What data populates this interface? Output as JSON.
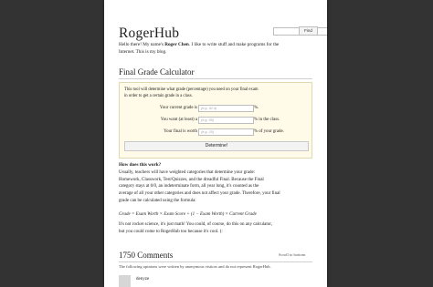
{
  "header": {
    "site_title": "RogerHub",
    "search_placeholder": "",
    "find_label": "Find"
  },
  "intro": {
    "prefix": "Hello there! My name's ",
    "name": "Roger Chen",
    "line1_rest": ". I like to write stuff and make programs for the",
    "line2": "Internet. This is my blog."
  },
  "calculator": {
    "title": "Final Grade Calculator",
    "description_line1": "This tool will determine what grade (percentage) you need on your final exam",
    "description_line2": "in order to get a certain grade in a class.",
    "rows": [
      {
        "label": "Your current grade is",
        "placeholder": "(e.g. 92.4)",
        "suffix": "%."
      },
      {
        "label": "You want (at least) a",
        "placeholder": "(e.g. 85)",
        "suffix": "% in the class."
      },
      {
        "label": "Your final is worth",
        "placeholder": "(e.g. 20)",
        "suffix": "% of your grade."
      }
    ],
    "button_label": "Determine!"
  },
  "how": {
    "title": "How does this work?",
    "lines": [
      "Usually, teachers will have weighted categories that determine your grade:",
      "Homework, Classwork, Test/Quizzes, and the dreadful Final. Because the Final",
      "category stays at 0/0, an indeterminate form, all year long, it's counted as the",
      "average of all your other categories and does not affect your grade. Therefore, your final",
      "grade can be calculated using the formula:"
    ],
    "formula": "Grade = Exam Worth × Exam Score + (1 − Exam Worth) × Current Grade",
    "note_line1": "It's not rocket science, it's just math! You could, of course, do this on any calculator,",
    "note_line2": "but you could come to RogerHub too because it's cool. (:"
  },
  "comments": {
    "title": "1750 Comments",
    "scroll_link": "Scroll to bottom",
    "note": "The following opinions were written by anonymous visitors and do not represent RogerHub.",
    "first_author": "denyze"
  },
  "colors": {
    "background": "#333333",
    "page": "#ffffff",
    "calculator_bg": "#fffbe8"
  }
}
